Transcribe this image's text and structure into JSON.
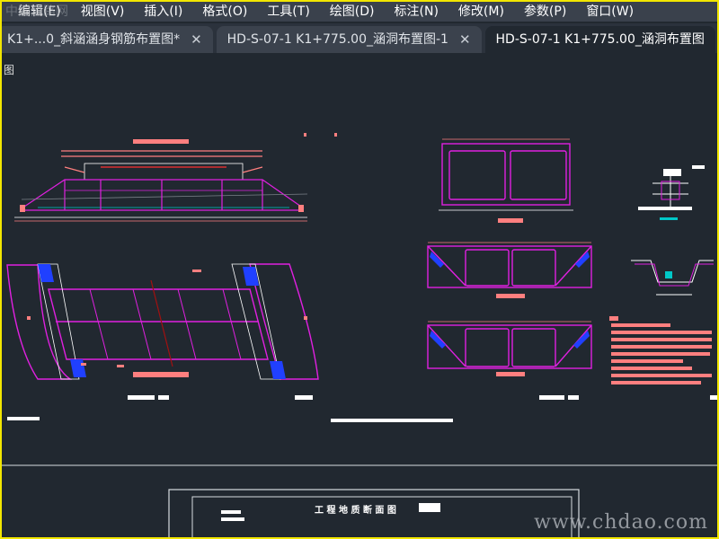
{
  "menubar": {
    "items": [
      {
        "label": "编辑(E)"
      },
      {
        "label": "视图(V)"
      },
      {
        "label": "插入(I)"
      },
      {
        "label": "格式(O)"
      },
      {
        "label": "工具(T)"
      },
      {
        "label": "绘图(D)"
      },
      {
        "label": "标注(N)"
      },
      {
        "label": "修改(M)"
      },
      {
        "label": "参数(P)"
      },
      {
        "label": "窗口(W)"
      }
    ]
  },
  "tabs": [
    {
      "label": "K1+...0_斜涵涵身钢筋布置图*",
      "close": "✕"
    },
    {
      "label": "HD-S-07-1 K1+775.00_涵洞布置图-1",
      "close": "✕"
    },
    {
      "label": "HD-S-07-1 K1+775.00_涵洞布置图",
      "close": ""
    }
  ],
  "viewport": {
    "view_label": "图",
    "title_block_text": "工 程 地 质 断 面 图",
    "watermark": "www.chdao.com",
    "top_watermark": "中国道路网"
  },
  "colors": {
    "background": "#212830",
    "magenta": "#e020e0",
    "salmon": "#ff7f7f",
    "white": "#ffffff",
    "blue": "#2040ff",
    "cyan": "#00c8c8",
    "frame": "#f2e600"
  }
}
